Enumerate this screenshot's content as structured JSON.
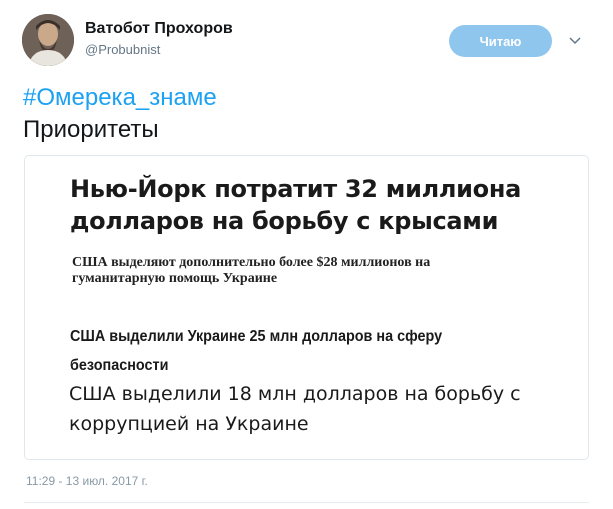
{
  "user": {
    "display_name": "Ватобот Прохоров",
    "handle": "@Probubnist",
    "avatar_icon": "user-avatar"
  },
  "follow_button": {
    "label": "Читаю",
    "color": "#8fc6ee"
  },
  "menu_icon": "chevron-down-icon",
  "tweet": {
    "hashtag": "#Омерека_знаме",
    "text": "Приоритеты",
    "hashtag_color": "#1da1f2"
  },
  "media": {
    "headlines": [
      "Нью-Йорк потратит 32 миллиона долларов на борьбу с крысами",
      "США выделяют дополнительно более $28 миллионов на гуманитарную помощь Украине",
      "США выделили Украине 25 млн долларов на сферу безопасности",
      "США выделили 18 млн долларов на борьбу с коррупцией на Украине"
    ]
  },
  "timestamp": "11:29 - 13 июл. 2017 г."
}
